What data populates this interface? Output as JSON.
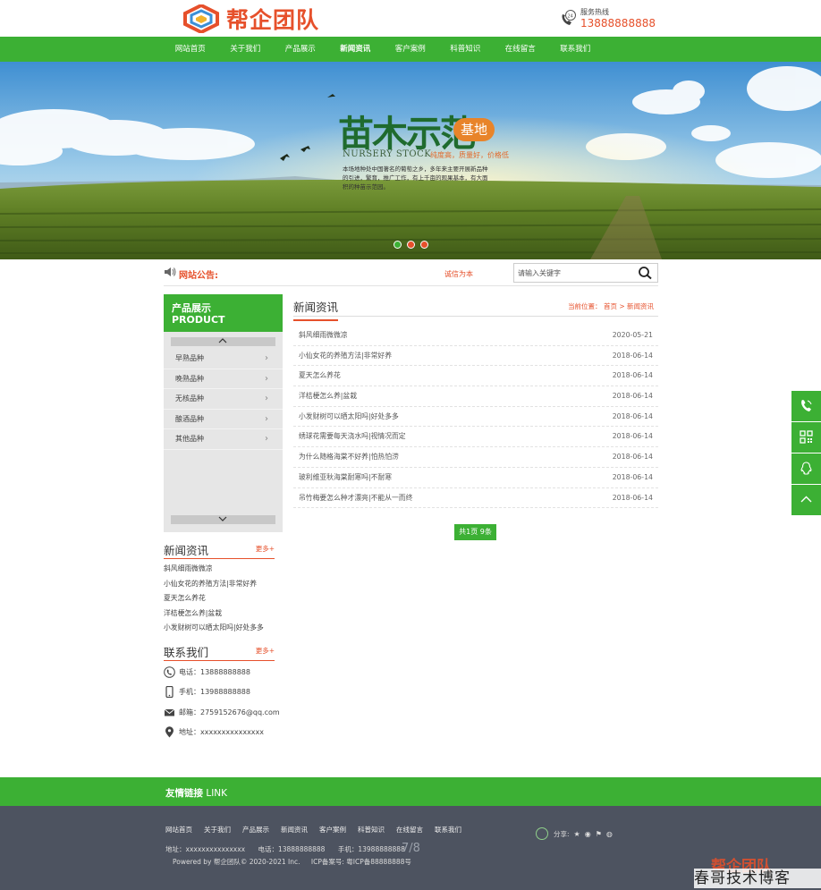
{
  "header": {
    "logo_text": "帮企团队",
    "hotline_label": "服务热线",
    "hotline_number": "13888888888"
  },
  "nav": {
    "items": [
      "网站首页",
      "关于我们",
      "产品展示",
      "新闻资讯",
      "客户案例",
      "科普知识",
      "在线留言",
      "联系我们"
    ]
  },
  "banner": {
    "title": "苗木示范",
    "badge": "基地",
    "subtitle_en": "NURSERY STOCK",
    "tagline": "纯度高，质量好，价格低",
    "description": "本场地种处中国著名的葡萄之乡，多年来主要开展新品种的引进，繁育，推广工作，有上千亩的观果基本，有大面积的种苗示范园。"
  },
  "notice": {
    "label": "网站公告:",
    "text": "诚信为本",
    "search_placeholder": "请输入关键字"
  },
  "sidebar": {
    "title_cn": "产品展示",
    "title_en": "PRODUCT",
    "items": [
      "早熟品种",
      "晚熟品种",
      "无核品种",
      "酿酒品种",
      "其他品种"
    ],
    "news_title": "新闻资讯",
    "news_more": "更多+",
    "news_items": [
      "斜风细雨微微凉",
      "小仙女花的养殖方法|非常好养",
      "夏天怎么养花",
      "洋桔梗怎么养|盆栽",
      "小发财树可以晒太阳吗|好处多多"
    ],
    "contact_title": "联系我们",
    "contact_more": "更多+",
    "contact": {
      "phone": "电话：13888888888",
      "mobile": "手机：13988888888",
      "email": "邮箱：2759152676@qq.com",
      "address": "地址：xxxxxxxxxxxxxxx"
    }
  },
  "main": {
    "title": "新闻资讯",
    "breadcrumb": "当前位置：  首页 > 新闻资讯",
    "news": [
      {
        "title": "斜风细雨微微凉",
        "date": "2020-05-21"
      },
      {
        "title": "小仙女花的养殖方法|非常好养",
        "date": "2018-06-14"
      },
      {
        "title": "夏天怎么养花",
        "date": "2018-06-14"
      },
      {
        "title": "洋桔梗怎么养|盆栽",
        "date": "2018-06-14"
      },
      {
        "title": "小发财树可以晒太阳吗|好处多多",
        "date": "2018-06-14"
      },
      {
        "title": "绣球花需要每天浇水吗|视情况而定",
        "date": "2018-06-14"
      },
      {
        "title": "为什么随格海棠不好养|怕热怕涝",
        "date": "2018-06-14"
      },
      {
        "title": "玻利维亚秋海棠耐寒吗|不耐寒",
        "date": "2018-06-14"
      },
      {
        "title": "吊竹梅要怎么种才漂亮|不能从一而终",
        "date": "2018-06-14"
      }
    ],
    "pager": "共1页 9条"
  },
  "footer": {
    "link_title_bold": "友情链接",
    "link_title_en": "LINK",
    "nav": [
      "网站首页",
      "关于我们",
      "产品展示",
      "新闻资讯",
      "客户案例",
      "科普知识",
      "在线留言",
      "联系我们"
    ],
    "share_label": "分享:",
    "address": "地址：xxxxxxxxxxxxxxx",
    "phone": "电话：13888888888",
    "mobile": "手机：13988888888",
    "page_indicator": "7/8",
    "copyright": "Powered by 帮企团队© 2020-2021 Inc.",
    "icp": "ICP备案号: 粤ICP备88888888号"
  },
  "watermark": {
    "logo_text": "帮企团队",
    "text": "春哥技术博客"
  },
  "colors": {
    "brand_green": "#3cb034",
    "accent_orange": "#e6502b",
    "footer_bg": "#4d5360"
  }
}
